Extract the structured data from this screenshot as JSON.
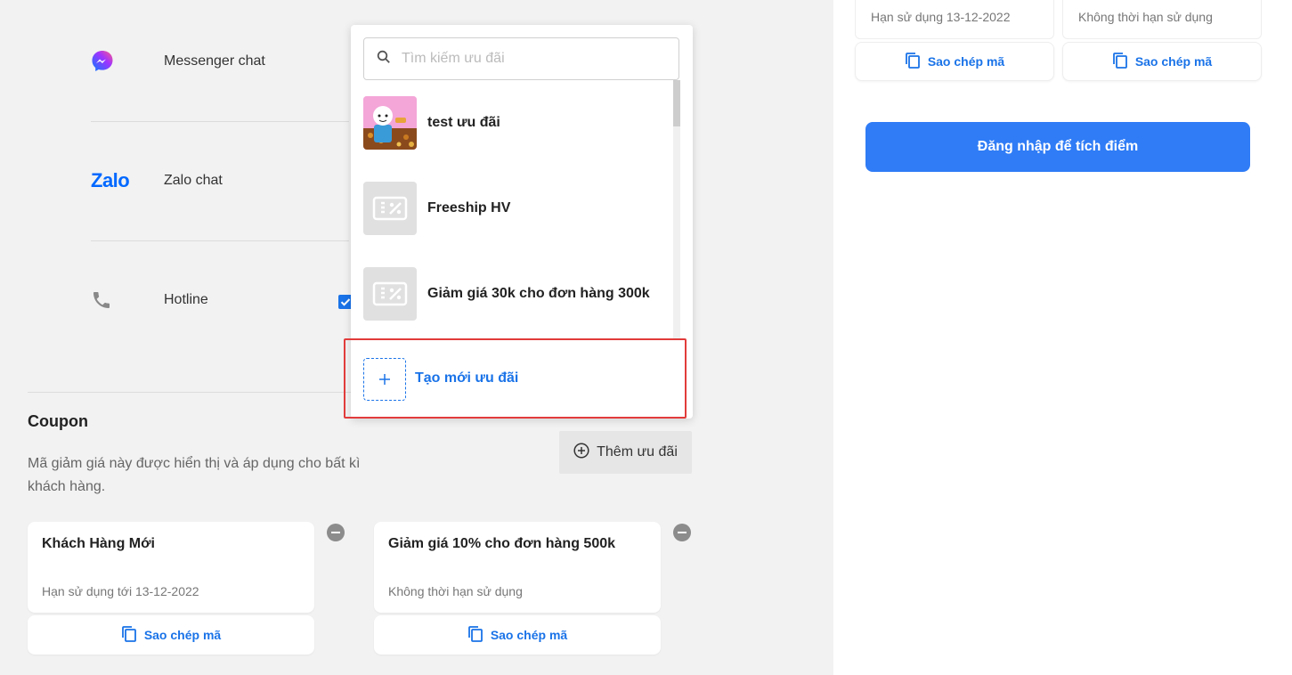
{
  "contacts": [
    {
      "label": "Messenger chat",
      "icon": "messenger-icon"
    },
    {
      "label": "Zalo chat",
      "icon": "zalo-logo",
      "logo_text": "Zalo"
    },
    {
      "label": "Hotline",
      "icon": "phone-icon"
    }
  ],
  "coupon": {
    "title": "Coupon",
    "description": "Mã giảm giá này được hiển thị và áp dụng cho bất kì khách hàng.",
    "add_button": "Thêm ưu đãi",
    "cards": [
      {
        "title": "Khách Hàng Mới",
        "expiry": "Hạn sử dụng tới 13-12-2022",
        "copy": "Sao chép mã"
      },
      {
        "title": "Giảm giá 10% cho đơn hàng 500k",
        "expiry": "Không thời hạn sử dụng",
        "copy": "Sao chép mã"
      }
    ]
  },
  "dropdown": {
    "search_placeholder": "Tìm kiếm ưu đãi",
    "items": [
      {
        "name": "test ưu đãi"
      },
      {
        "name": "Freeship HV"
      },
      {
        "name": "Giảm giá 30k cho đơn hàng 300k"
      }
    ],
    "create_label": "Tạo mới ưu đãi"
  },
  "preview": {
    "cards": [
      {
        "expiry": "Hạn sử dụng 13-12-2022",
        "copy": "Sao chép mã"
      },
      {
        "expiry": "Không thời hạn sử dụng",
        "copy": "Sao chép mã"
      }
    ],
    "login_button": "Đăng nhập để tích điểm"
  },
  "colors": {
    "accent": "#1a73e8",
    "login_button": "#2f7cf6",
    "highlight": "#e23b3b"
  }
}
